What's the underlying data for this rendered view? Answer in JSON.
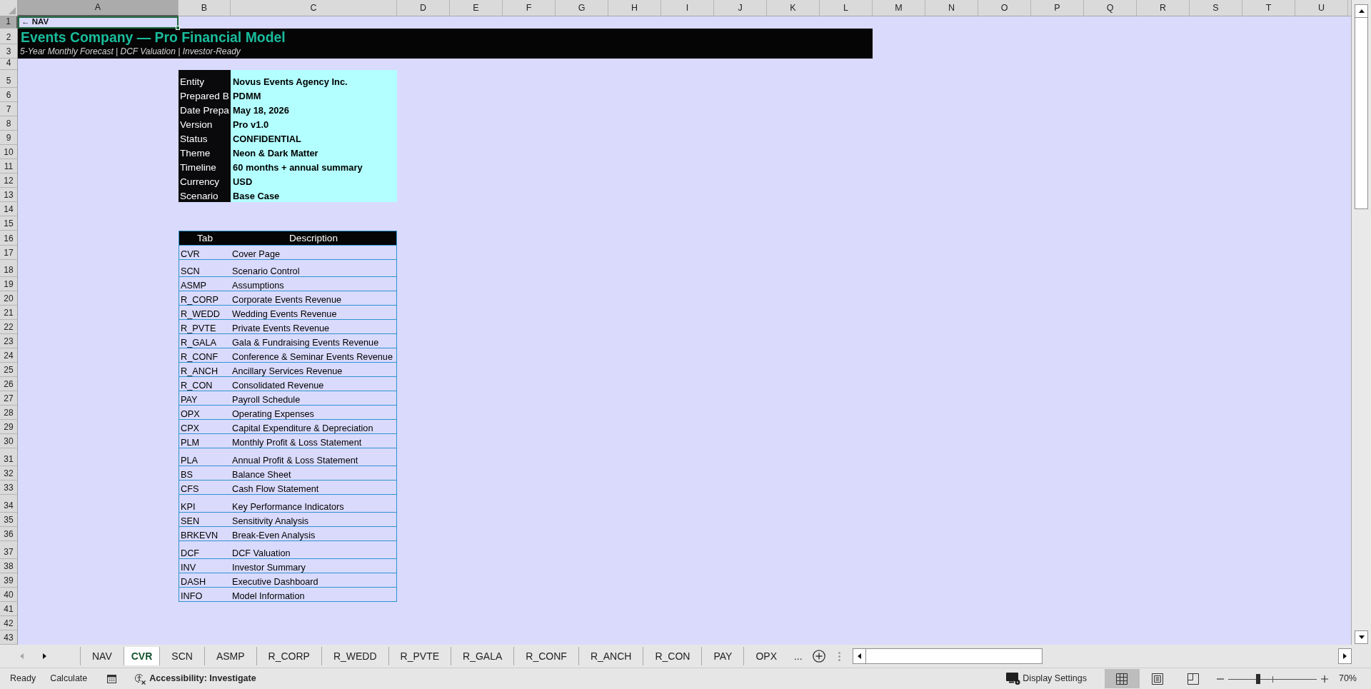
{
  "column_headers": [
    {
      "label": "A",
      "selected": true
    },
    {
      "label": "B",
      "selected": false
    },
    {
      "label": "C",
      "selected": false
    },
    {
      "label": "D",
      "selected": false
    },
    {
      "label": "E",
      "selected": false
    },
    {
      "label": "F",
      "selected": false
    },
    {
      "label": "G",
      "selected": false
    },
    {
      "label": "H",
      "selected": false
    },
    {
      "label": "I",
      "selected": false
    },
    {
      "label": "J",
      "selected": false
    },
    {
      "label": "K",
      "selected": false
    },
    {
      "label": "L",
      "selected": false
    },
    {
      "label": "M",
      "selected": false
    },
    {
      "label": "N",
      "selected": false
    },
    {
      "label": "O",
      "selected": false
    },
    {
      "label": "P",
      "selected": false
    },
    {
      "label": "Q",
      "selected": false
    },
    {
      "label": "R",
      "selected": false
    },
    {
      "label": "S",
      "selected": false
    },
    {
      "label": "T",
      "selected": false
    },
    {
      "label": "U",
      "selected": false
    }
  ],
  "row_headers": [
    {
      "label": "1",
      "selected": true
    },
    {
      "label": "2",
      "selected": false
    },
    {
      "label": "3",
      "selected": false
    },
    {
      "label": "4",
      "selected": false
    },
    {
      "label": "5",
      "selected": false
    },
    {
      "label": "6",
      "selected": false
    },
    {
      "label": "7",
      "selected": false
    },
    {
      "label": "8",
      "selected": false
    },
    {
      "label": "9",
      "selected": false
    },
    {
      "label": "10",
      "selected": false
    },
    {
      "label": "11",
      "selected": false
    },
    {
      "label": "12",
      "selected": false
    },
    {
      "label": "13",
      "selected": false
    },
    {
      "label": "14",
      "selected": false
    },
    {
      "label": "15",
      "selected": false
    },
    {
      "label": "16",
      "selected": false
    },
    {
      "label": "17",
      "selected": false
    },
    {
      "label": "18",
      "selected": false
    },
    {
      "label": "19",
      "selected": false
    },
    {
      "label": "20",
      "selected": false
    },
    {
      "label": "21",
      "selected": false
    },
    {
      "label": "22",
      "selected": false
    },
    {
      "label": "23",
      "selected": false
    },
    {
      "label": "24",
      "selected": false
    },
    {
      "label": "25",
      "selected": false
    },
    {
      "label": "26",
      "selected": false
    },
    {
      "label": "27",
      "selected": false
    },
    {
      "label": "28",
      "selected": false
    },
    {
      "label": "29",
      "selected": false
    },
    {
      "label": "30",
      "selected": false
    },
    {
      "label": "31",
      "selected": false
    },
    {
      "label": "32",
      "selected": false
    },
    {
      "label": "33",
      "selected": false
    },
    {
      "label": "34",
      "selected": false
    },
    {
      "label": "35",
      "selected": false
    },
    {
      "label": "36",
      "selected": false
    },
    {
      "label": "37",
      "selected": false
    },
    {
      "label": "38",
      "selected": false
    },
    {
      "label": "39",
      "selected": false
    },
    {
      "label": "40",
      "selected": false
    },
    {
      "label": "41",
      "selected": false
    },
    {
      "label": "42",
      "selected": false
    },
    {
      "label": "43",
      "selected": false
    }
  ],
  "nav_cell": {
    "text": "← NAV",
    "active": true
  },
  "title_banner": {
    "heading": "Events Company — Pro Financial Model",
    "subtitle": "5-Year Monthly Forecast | DCF Valuation | Investor-Ready"
  },
  "info_table": [
    {
      "label": "Entity",
      "value": "Novus Events Agency Inc."
    },
    {
      "label": "Prepared B",
      "value": "PDMM"
    },
    {
      "label": "Date Prepa",
      "value": "May 18, 2026"
    },
    {
      "label": "Version",
      "value": "Pro v1.0"
    },
    {
      "label": "Status",
      "value": "CONFIDENTIAL"
    },
    {
      "label": "Theme",
      "value": "Neon & Dark Matter"
    },
    {
      "label": "Timeline",
      "value": "60 months + annual summary"
    },
    {
      "label": "Currency",
      "value": "USD"
    },
    {
      "label": "Scenario",
      "value": "Base Case"
    }
  ],
  "tab_table": {
    "columns": [
      "Tab",
      "Description"
    ],
    "rows": [
      {
        "tab": "CVR",
        "description": "Cover Page"
      },
      {
        "tab": "SCN",
        "description": "Scenario Control"
      },
      {
        "tab": "ASMP",
        "description": "Assumptions"
      },
      {
        "tab": "R_CORP",
        "description": "Corporate Events Revenue"
      },
      {
        "tab": "R_WEDD",
        "description": "Wedding Events Revenue"
      },
      {
        "tab": "R_PVTE",
        "description": "Private Events Revenue"
      },
      {
        "tab": "R_GALA",
        "description": "Gala & Fundraising Events Revenue"
      },
      {
        "tab": "R_CONF",
        "description": "Conference & Seminar Events Revenue"
      },
      {
        "tab": "R_ANCH",
        "description": "Ancillary Services Revenue"
      },
      {
        "tab": "R_CON",
        "description": "Consolidated Revenue"
      },
      {
        "tab": "PAY",
        "description": "Payroll Schedule"
      },
      {
        "tab": "OPX",
        "description": "Operating Expenses"
      },
      {
        "tab": "CPX",
        "description": "Capital Expenditure & Depreciation"
      },
      {
        "tab": "PLM",
        "description": "Monthly Profit & Loss Statement"
      },
      {
        "tab": "PLA",
        "description": "Annual Profit & Loss Statement"
      },
      {
        "tab": "BS",
        "description": "Balance Sheet"
      },
      {
        "tab": "CFS",
        "description": "Cash Flow Statement"
      },
      {
        "tab": "KPI",
        "description": "Key Performance Indicators"
      },
      {
        "tab": "SEN",
        "description": "Sensitivity Analysis"
      },
      {
        "tab": "BRKEVN",
        "description": "Break-Even Analysis"
      },
      {
        "tab": "DCF",
        "description": "DCF Valuation"
      },
      {
        "tab": "INV",
        "description": "Investor Summary"
      },
      {
        "tab": "DASH",
        "description": "Executive Dashboard"
      },
      {
        "tab": "INFO",
        "description": "Model Information"
      }
    ]
  },
  "sheet_nav": [
    {
      "kind": "previous",
      "disabled": true
    },
    {
      "kind": "next",
      "disabled": false
    }
  ],
  "sheet_tabs": [
    {
      "label": "NAV",
      "selected": false
    },
    {
      "label": "CVR",
      "selected": true
    },
    {
      "label": "SCN",
      "selected": false
    },
    {
      "label": "ASMP",
      "selected": false
    },
    {
      "label": "R_CORP",
      "selected": false
    },
    {
      "label": "R_WEDD",
      "selected": false
    },
    {
      "label": "R_PVTE",
      "selected": false
    },
    {
      "label": "R_GALA",
      "selected": false
    },
    {
      "label": "R_CONF",
      "selected": false
    },
    {
      "label": "R_ANCH",
      "selected": false
    },
    {
      "label": "R_CON",
      "selected": false
    },
    {
      "label": "PAY",
      "selected": false
    },
    {
      "label": "OPX",
      "selected": false
    }
  ],
  "more_sheets": "...",
  "status_bar": {
    "mode": "Ready",
    "calculate": "Calculate",
    "accessibility": "Accessibility: Investigate",
    "display_settings": "Display Settings",
    "views": [
      {
        "kind": "normal",
        "selected": true
      },
      {
        "kind": "page_layout",
        "selected": false
      },
      {
        "kind": "page_break",
        "selected": false
      }
    ],
    "zoom": {
      "level": 0.34,
      "reading": "70%"
    }
  }
}
